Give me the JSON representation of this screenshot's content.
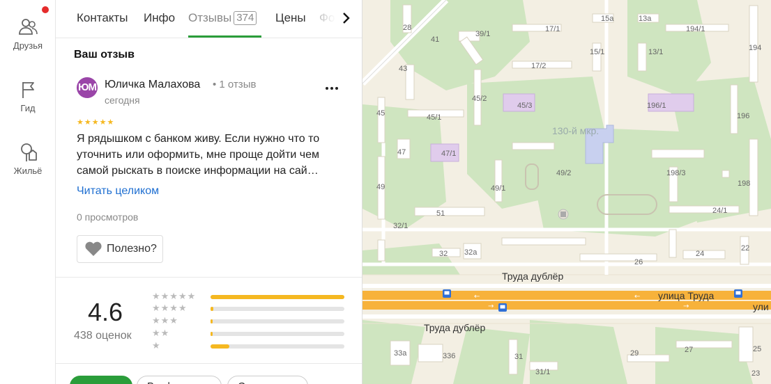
{
  "rail": {
    "items": [
      {
        "label": "Друзья",
        "icon": "friends-icon"
      },
      {
        "label": "Гид",
        "icon": "flag-icon"
      },
      {
        "label": "Жильё",
        "icon": "tree-house-icon"
      }
    ],
    "notification": true
  },
  "tabs": [
    {
      "label": "Контакты"
    },
    {
      "label": "Инфо"
    },
    {
      "label": "Отзывы",
      "count": "374",
      "active": true
    },
    {
      "label": "Цены"
    },
    {
      "label": "Фо"
    }
  ],
  "review": {
    "section_title": "Ваш отзыв",
    "avatar_text": "ЮМ",
    "author": "Юличка Малахова",
    "author_meta": "• 1 отзыв",
    "date": "сегодня",
    "stars": "★★★★★",
    "text": "Я рядышком с банком живу. Если нужно что то уточнить или оформить, мне проще дойти чем самой рыскать в поиске информации на сай…",
    "read_more": "Читать целиком",
    "views": "0 просмотров",
    "useful_label": "Полезно?"
  },
  "rating": {
    "value": "4.6",
    "count_label": "438 оценок",
    "distribution": [
      {
        "stars": "★★★★★",
        "fraction": 1.0
      },
      {
        "stars": "★★★★",
        "fraction": 0.02
      },
      {
        "stars": "★★★",
        "fraction": 0.015
      },
      {
        "stars": "★★",
        "fraction": 0.015
      },
      {
        "stars": "★",
        "fraction": 0.14
      }
    ]
  },
  "filters": [
    {
      "label": ""
    },
    {
      "label": "Вы ф"
    },
    {
      "label": "С"
    }
  ],
  "map": {
    "district": "130-й мкр.",
    "streets": [
      "Труда дублёр",
      "улица Труда",
      "Труда дублёр",
      "ули"
    ],
    "houses": [
      "28",
      "41",
      "39/1",
      "43",
      "45",
      "45/1",
      "45/2",
      "45/3",
      "47",
      "47/1",
      "49",
      "49/1",
      "49/2",
      "51",
      "32/1",
      "32",
      "32a",
      "17/1",
      "17/2",
      "15a",
      "13a",
      "15/1",
      "13/1",
      "194/1",
      "194",
      "196/1",
      "196",
      "198/3",
      "198",
      "24/1",
      "22",
      "24",
      "26",
      "33a",
      "336",
      "31",
      "31/1",
      "29",
      "27",
      "25",
      "23"
    ],
    "colors": {
      "background": "#f3efe3",
      "park": "#cfe5c0",
      "road": "#f7b23b",
      "building": "#ffffff",
      "school": "#c8d0ef"
    }
  }
}
